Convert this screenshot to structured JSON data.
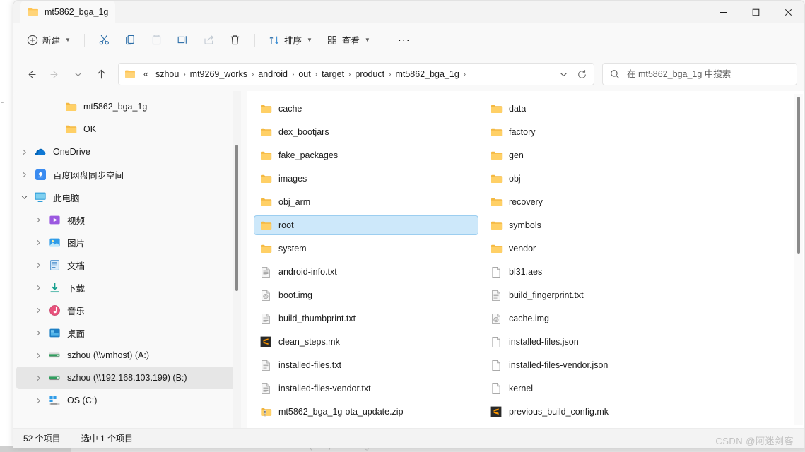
{
  "window": {
    "tab_title": "mt5862_bga_1g",
    "controls": {
      "minimize": "—",
      "maximize": "☐",
      "close": "✕"
    }
  },
  "toolbar": {
    "new_label": "新建",
    "cut_label": "剪切",
    "copy_label": "复制",
    "paste_label": "粘贴",
    "rename_label": "重命名",
    "share_label": "共享",
    "delete_label": "删除",
    "sort_label": "排序",
    "view_label": "查看",
    "more_label": "···"
  },
  "address": {
    "back": "←",
    "forward": "→",
    "recent_chevron": "⌄",
    "up": "↑",
    "overflow": "«",
    "crumbs": [
      "szhou",
      "mt9269_works",
      "android",
      "out",
      "target",
      "product",
      "mt5862_bga_1g"
    ],
    "separator": "›",
    "dropdown_chevron": "⌄",
    "refresh": "↻"
  },
  "search": {
    "placeholder": "在 mt5862_bga_1g 中搜索",
    "value": ""
  },
  "navpane": {
    "items": [
      {
        "label": "mt5862_bga_1g",
        "icon": "folder-icon",
        "indent": 2,
        "chevron": "",
        "selected": false
      },
      {
        "label": "OK",
        "icon": "folder-icon",
        "indent": 2,
        "chevron": "",
        "selected": false
      },
      {
        "label": "OneDrive",
        "icon": "onedrive-icon",
        "indent": 0,
        "chevron": "›",
        "selected": false
      },
      {
        "label": "百度网盘同步空间",
        "icon": "baidu-netdisk-icon",
        "indent": 0,
        "chevron": "›",
        "selected": false
      },
      {
        "label": "此电脑",
        "icon": "this-pc-icon",
        "indent": 0,
        "chevron": "⌄",
        "selected": false
      },
      {
        "label": "视频",
        "icon": "videos-icon",
        "indent": 1,
        "chevron": "›",
        "selected": false
      },
      {
        "label": "图片",
        "icon": "pictures-icon",
        "indent": 1,
        "chevron": "›",
        "selected": false
      },
      {
        "label": "文档",
        "icon": "documents-icon",
        "indent": 1,
        "chevron": "›",
        "selected": false
      },
      {
        "label": "下载",
        "icon": "downloads-icon",
        "indent": 1,
        "chevron": "›",
        "selected": false
      },
      {
        "label": "音乐",
        "icon": "music-icon",
        "indent": 1,
        "chevron": "›",
        "selected": false
      },
      {
        "label": "桌面",
        "icon": "desktop-icon",
        "indent": 1,
        "chevron": "›",
        "selected": false
      },
      {
        "label": "szhou (\\\\vmhost) (A:)",
        "icon": "network-drive-icon",
        "indent": 1,
        "chevron": "›",
        "selected": false
      },
      {
        "label": "szhou (\\\\192.168.103.199) (B:)",
        "icon": "network-drive-icon",
        "indent": 1,
        "chevron": "›",
        "selected": true
      },
      {
        "label": "OS (C:)",
        "icon": "local-disk-icon",
        "indent": 1,
        "chevron": "›",
        "selected": false
      }
    ]
  },
  "files": {
    "column1": [
      {
        "name": "cache",
        "type": "folder",
        "selected": false
      },
      {
        "name": "dex_bootjars",
        "type": "folder",
        "selected": false
      },
      {
        "name": "fake_packages",
        "type": "folder",
        "selected": false
      },
      {
        "name": "images",
        "type": "folder",
        "selected": false
      },
      {
        "name": "obj_arm",
        "type": "folder",
        "selected": false
      },
      {
        "name": "root",
        "type": "folder",
        "selected": true
      },
      {
        "name": "system",
        "type": "folder",
        "selected": false
      },
      {
        "name": "android-info.txt",
        "type": "text",
        "selected": false
      },
      {
        "name": "boot.img",
        "type": "disc-image",
        "selected": false
      },
      {
        "name": "build_thumbprint.txt",
        "type": "text",
        "selected": false
      },
      {
        "name": "clean_steps.mk",
        "type": "sublime",
        "selected": false
      },
      {
        "name": "installed-files.txt",
        "type": "text",
        "selected": false
      },
      {
        "name": "installed-files-vendor.txt",
        "type": "text",
        "selected": false
      },
      {
        "name": "mt5862_bga_1g-ota_update.zip",
        "type": "zip",
        "selected": false
      }
    ],
    "column2": [
      {
        "name": "data",
        "type": "folder",
        "selected": false
      },
      {
        "name": "factory",
        "type": "folder",
        "selected": false
      },
      {
        "name": "gen",
        "type": "folder",
        "selected": false
      },
      {
        "name": "obj",
        "type": "folder",
        "selected": false
      },
      {
        "name": "recovery",
        "type": "folder",
        "selected": false
      },
      {
        "name": "symbols",
        "type": "folder",
        "selected": false
      },
      {
        "name": "vendor",
        "type": "folder",
        "selected": false
      },
      {
        "name": "bl31.aes",
        "type": "blank",
        "selected": false
      },
      {
        "name": "build_fingerprint.txt",
        "type": "text",
        "selected": false
      },
      {
        "name": "cache.img",
        "type": "disc-image",
        "selected": false
      },
      {
        "name": "installed-files.json",
        "type": "blank",
        "selected": false
      },
      {
        "name": "installed-files-vendor.json",
        "type": "blank",
        "selected": false
      },
      {
        "name": "kernel",
        "type": "blank",
        "selected": false
      },
      {
        "name": "previous_build_config.mk",
        "type": "sublime",
        "selected": false
      }
    ]
  },
  "statusbar": {
    "item_count": "52 个项目",
    "selection": "选中 1 个项目"
  },
  "watermark": {
    "text": "CSDN @阿迷剑客"
  },
  "background": {
    "left_fragments": "- (\n/c\n\n)/\n",
    "bottom_text": "+(□□□)  □□□□ *g"
  },
  "colors": {
    "accent": "#0078d4",
    "selection": "#cde8fa",
    "folder": "#ffc94d",
    "window_bg": "#f9f9f9"
  }
}
